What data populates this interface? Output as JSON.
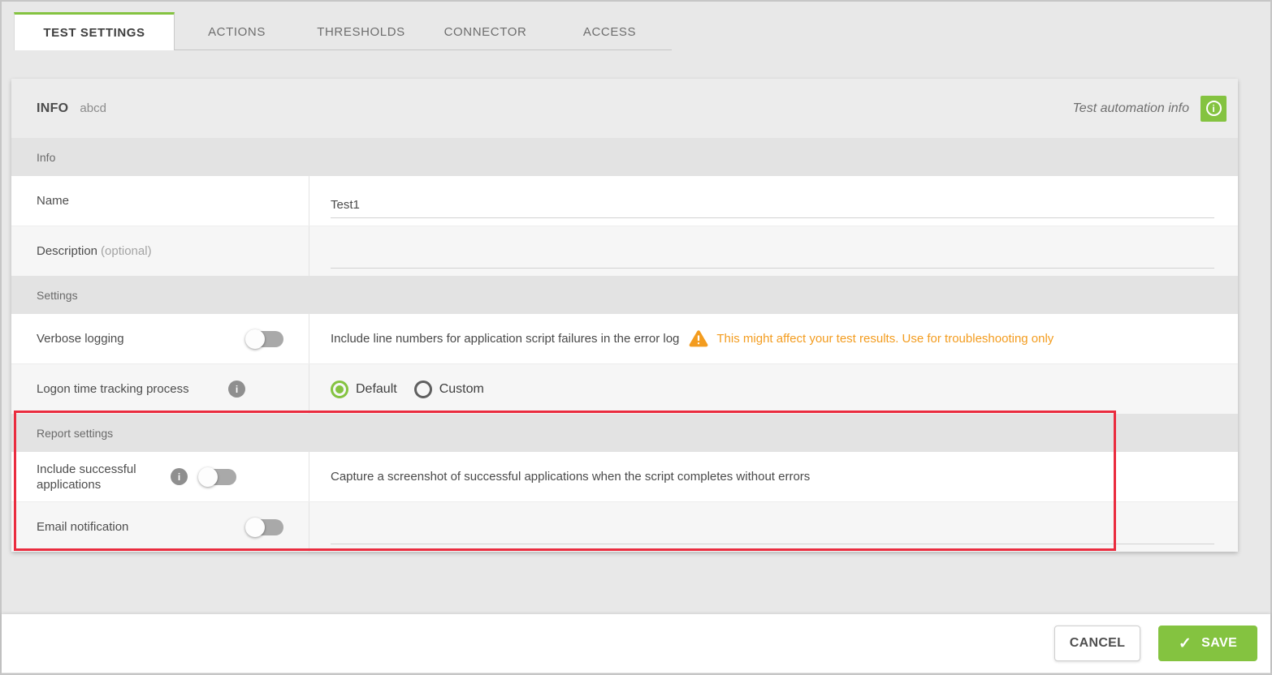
{
  "colors": {
    "accent": "#84c340",
    "warning": "#f39c1f",
    "highlight": "#ea2c3f"
  },
  "icons": {
    "info_glyph": "i",
    "warning_glyph": "!",
    "check_glyph": "✓"
  },
  "tabs": [
    {
      "label": "TEST SETTINGS",
      "active": true
    },
    {
      "label": "ACTIONS",
      "active": false
    },
    {
      "label": "THRESHOLDS",
      "active": false
    },
    {
      "label": "CONNECTOR",
      "active": false
    },
    {
      "label": "ACCESS",
      "active": false
    }
  ],
  "panel": {
    "header": {
      "title": "INFO",
      "subtitle": "abcd",
      "right_label": "Test automation info"
    },
    "sections": {
      "info": "Info",
      "settings": "Settings",
      "report": "Report settings"
    },
    "fields": {
      "name": {
        "label": "Name",
        "value": "Test1"
      },
      "description": {
        "label": "Description",
        "optional": "(optional)",
        "value": "",
        "placeholder": ""
      },
      "verbose": {
        "label": "Verbose logging",
        "toggle_state": "off",
        "description": "Include line numbers for application script failures in the error log",
        "warning": "This might affect your test results. Use for troubleshooting only"
      },
      "logon": {
        "label": "Logon time tracking process",
        "options": [
          {
            "label": "Default",
            "selected": true
          },
          {
            "label": "Custom",
            "selected": false
          }
        ]
      },
      "include_successful": {
        "label": "Include successful applications",
        "toggle_state": "off",
        "description": "Capture a screenshot of successful applications when the script completes without errors"
      },
      "email": {
        "label": "Email notification",
        "toggle_state": "off",
        "value": "",
        "placeholder": ""
      }
    }
  },
  "footer": {
    "cancel_label": "CANCEL",
    "save_label": "SAVE"
  }
}
